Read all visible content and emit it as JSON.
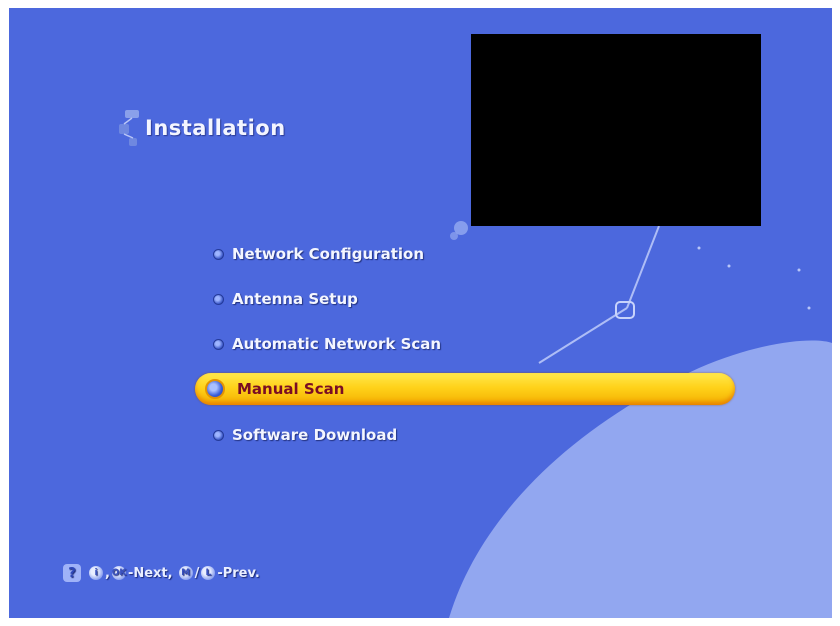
{
  "screen": {
    "title": "Installation",
    "colors": {
      "background": "#4c68dd",
      "highlight": "#ffd21a",
      "selected_text": "#7a0d24",
      "text": "#f4f6ff"
    }
  },
  "menu": {
    "items": [
      {
        "label": "Network Configuration"
      },
      {
        "label": "Antenna Setup"
      },
      {
        "label": "Automatic Network Scan"
      },
      {
        "label": "Manual Scan",
        "selected": true
      },
      {
        "label": "Software Download"
      }
    ]
  },
  "help": {
    "icon": "help-icon",
    "key_info": "i",
    "key_ok": "OK",
    "next_label": "-Next,",
    "key_menu": "M",
    "separator": "/",
    "key_left": "L",
    "prev_label": "-Prev."
  }
}
